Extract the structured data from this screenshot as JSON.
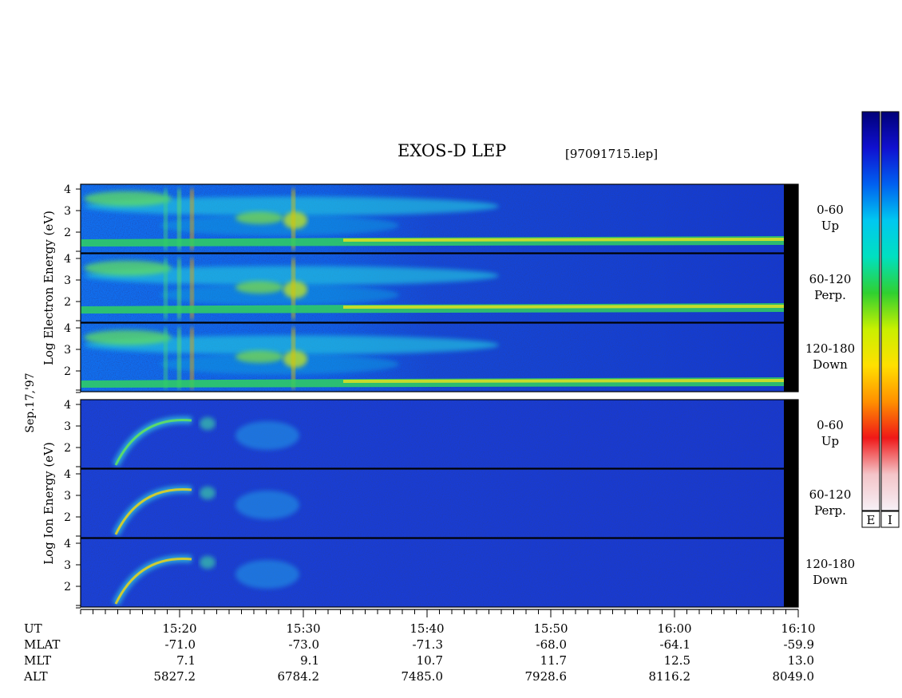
{
  "header": {
    "title": "EXOS-D LEP",
    "file": "[97091715.lep]"
  },
  "side_labels": {
    "date": "Sep.17,'97",
    "electron_axis": "Log  Electron  Energy  (eV)",
    "ion_axis": "Log  Ion  Energy  (eV)"
  },
  "colors": {
    "background": "#ffffff",
    "black_strip": "#000000",
    "colormap": [
      "#f6f0f6",
      "#f4c4c8",
      "#f01818",
      "#ff9000",
      "#ffe000",
      "#c8f000",
      "#30d030",
      "#00e0c0",
      "#00c8f0",
      "#0060f0",
      "#1010d0",
      "#000078"
    ]
  },
  "colorbars": [
    {
      "label": "E"
    },
    {
      "label": "I"
    }
  ],
  "chart_data": {
    "type": "heatmap",
    "x_unit": "UT",
    "x_range": [
      "15:12",
      "16:10"
    ],
    "y_ticks": [
      "4",
      "3",
      "2"
    ],
    "y_ticks_bottom": [
      "4",
      "3",
      "2",
      "1"
    ],
    "panels": [
      {
        "group": "electron",
        "label": [
          "0-60",
          "Up"
        ]
      },
      {
        "group": "electron",
        "label": [
          "60-120",
          "Perp."
        ]
      },
      {
        "group": "electron",
        "label": [
          "120-180",
          "Down"
        ]
      },
      {
        "group": "ion",
        "label": [
          "0-60",
          "Up"
        ]
      },
      {
        "group": "ion",
        "label": [
          "60-120",
          "Perp."
        ]
      },
      {
        "group": "ion",
        "label": [
          "120-180",
          "Down"
        ]
      }
    ],
    "ephemeris": {
      "rows": [
        {
          "name": "UT",
          "values": [
            "15:20",
            "15:30",
            "15:40",
            "15:50",
            "16:00",
            "16:10"
          ]
        },
        {
          "name": "MLAT",
          "values": [
            "-71.0",
            "-73.0",
            "-71.3",
            "-68.0",
            "-64.1",
            "-59.9"
          ]
        },
        {
          "name": "MLT",
          "values": [
            "7.1",
            "9.1",
            "10.7",
            "11.7",
            "12.5",
            "13.0"
          ]
        },
        {
          "name": "ALT",
          "values": [
            "5827.2",
            "6784.2",
            "7485.0",
            "7928.6",
            "8116.2",
            "8049.0"
          ]
        }
      ]
    }
  }
}
